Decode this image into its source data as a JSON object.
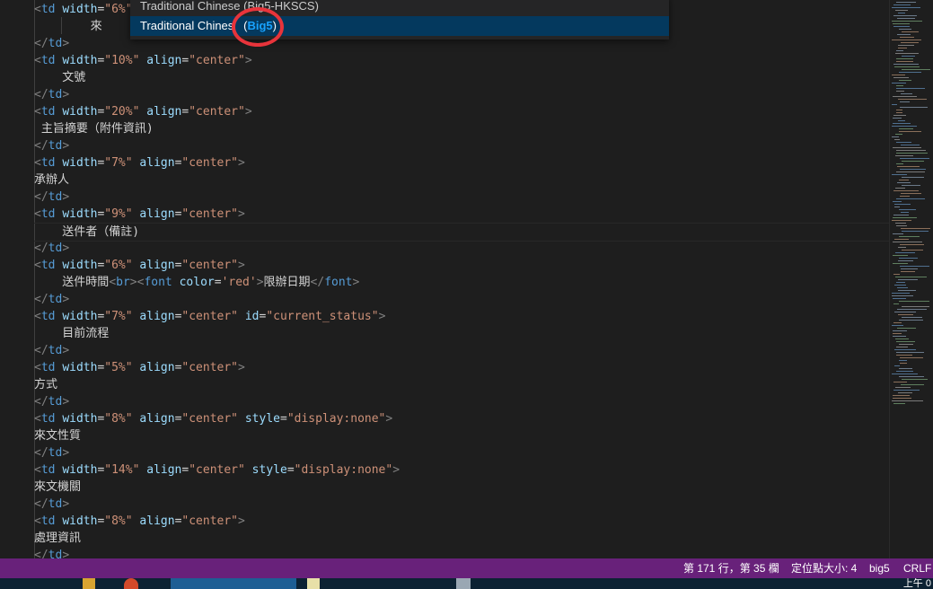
{
  "encoding_picker": {
    "items": [
      {
        "label": "Traditional Chinese (Big5-HKSCS)"
      },
      {
        "label_prefix": "Traditional Chines",
        "label_hidden": "e",
        "label_open": " (",
        "label_match": "Big5",
        "label_close": ")"
      }
    ]
  },
  "code_lines": [
    [
      {
        "t": "<",
        "c": "tg"
      },
      {
        "t": "td",
        "c": "tn"
      },
      {
        "t": " "
      },
      {
        "t": "width",
        "c": "an"
      },
      {
        "t": "=",
        "c": "tx"
      },
      {
        "t": "\"6%\"",
        "c": "av"
      }
    ],
    [
      {
        "t": "        來",
        "c": "tx"
      }
    ],
    [
      {
        "t": "</",
        "c": "tg"
      },
      {
        "t": "td",
        "c": "tn"
      },
      {
        "t": ">",
        "c": "tg"
      }
    ],
    [
      {
        "t": "<",
        "c": "tg"
      },
      {
        "t": "td",
        "c": "tn"
      },
      {
        "t": " "
      },
      {
        "t": "width",
        "c": "an"
      },
      {
        "t": "=",
        "c": "tx"
      },
      {
        "t": "\"10%\"",
        "c": "av"
      },
      {
        "t": " "
      },
      {
        "t": "align",
        "c": "an"
      },
      {
        "t": "=",
        "c": "tx"
      },
      {
        "t": "\"center\"",
        "c": "av"
      },
      {
        "t": ">",
        "c": "tg"
      }
    ],
    [
      {
        "t": "    文號",
        "c": "tx"
      }
    ],
    [
      {
        "t": "</",
        "c": "tg"
      },
      {
        "t": "td",
        "c": "tn"
      },
      {
        "t": ">",
        "c": "tg"
      }
    ],
    [
      {
        "t": "<",
        "c": "tg"
      },
      {
        "t": "td",
        "c": "tn"
      },
      {
        "t": " "
      },
      {
        "t": "width",
        "c": "an"
      },
      {
        "t": "=",
        "c": "tx"
      },
      {
        "t": "\"20%\"",
        "c": "av"
      },
      {
        "t": " "
      },
      {
        "t": "align",
        "c": "an"
      },
      {
        "t": "=",
        "c": "tx"
      },
      {
        "t": "\"center\"",
        "c": "av"
      },
      {
        "t": ">",
        "c": "tg"
      }
    ],
    [
      {
        "t": " 主旨摘要（附件資訊)",
        "c": "tx"
      }
    ],
    [
      {
        "t": "</",
        "c": "tg"
      },
      {
        "t": "td",
        "c": "tn"
      },
      {
        "t": ">",
        "c": "tg"
      }
    ],
    [
      {
        "t": "<",
        "c": "tg"
      },
      {
        "t": "td",
        "c": "tn"
      },
      {
        "t": " "
      },
      {
        "t": "width",
        "c": "an"
      },
      {
        "t": "=",
        "c": "tx"
      },
      {
        "t": "\"7%\"",
        "c": "av"
      },
      {
        "t": " "
      },
      {
        "t": "align",
        "c": "an"
      },
      {
        "t": "=",
        "c": "tx"
      },
      {
        "t": "\"center\"",
        "c": "av"
      },
      {
        "t": ">",
        "c": "tg"
      }
    ],
    [
      {
        "t": "承辦人",
        "c": "tx"
      }
    ],
    [
      {
        "t": "</",
        "c": "tg"
      },
      {
        "t": "td",
        "c": "tn"
      },
      {
        "t": ">",
        "c": "tg"
      }
    ],
    [
      {
        "t": "<",
        "c": "tg"
      },
      {
        "t": "td",
        "c": "tn"
      },
      {
        "t": " "
      },
      {
        "t": "width",
        "c": "an"
      },
      {
        "t": "=",
        "c": "tx"
      },
      {
        "t": "\"9%\"",
        "c": "av"
      },
      {
        "t": " "
      },
      {
        "t": "align",
        "c": "an"
      },
      {
        "t": "=",
        "c": "tx"
      },
      {
        "t": "\"center\"",
        "c": "av"
      },
      {
        "t": ">",
        "c": "tg"
      }
    ],
    [
      {
        "t": "    送件者（備註)",
        "c": "tx"
      }
    ],
    [
      {
        "t": "</",
        "c": "tg"
      },
      {
        "t": "td",
        "c": "tn"
      },
      {
        "t": ">",
        "c": "tg"
      }
    ],
    [
      {
        "t": "<",
        "c": "tg"
      },
      {
        "t": "td",
        "c": "tn"
      },
      {
        "t": " "
      },
      {
        "t": "width",
        "c": "an"
      },
      {
        "t": "=",
        "c": "tx"
      },
      {
        "t": "\"6%\"",
        "c": "av"
      },
      {
        "t": " "
      },
      {
        "t": "align",
        "c": "an"
      },
      {
        "t": "=",
        "c": "tx"
      },
      {
        "t": "\"center\"",
        "c": "av"
      },
      {
        "t": ">",
        "c": "tg"
      }
    ],
    [
      {
        "t": "    送件時間",
        "c": "tx"
      },
      {
        "t": "<",
        "c": "tg"
      },
      {
        "t": "br",
        "c": "tn"
      },
      {
        "t": ">",
        "c": "tg"
      },
      {
        "t": "<",
        "c": "tg"
      },
      {
        "t": "font",
        "c": "tn"
      },
      {
        "t": " "
      },
      {
        "t": "color",
        "c": "an"
      },
      {
        "t": "=",
        "c": "tx"
      },
      {
        "t": "'red'",
        "c": "av"
      },
      {
        "t": ">",
        "c": "tg"
      },
      {
        "t": "限辦日期",
        "c": "tx"
      },
      {
        "t": "</",
        "c": "tg"
      },
      {
        "t": "font",
        "c": "tn"
      },
      {
        "t": ">",
        "c": "tg"
      }
    ],
    [
      {
        "t": "</",
        "c": "tg"
      },
      {
        "t": "td",
        "c": "tn"
      },
      {
        "t": ">",
        "c": "tg"
      }
    ],
    [
      {
        "t": "<",
        "c": "tg"
      },
      {
        "t": "td",
        "c": "tn"
      },
      {
        "t": " "
      },
      {
        "t": "width",
        "c": "an"
      },
      {
        "t": "=",
        "c": "tx"
      },
      {
        "t": "\"7%\"",
        "c": "av"
      },
      {
        "t": " "
      },
      {
        "t": "align",
        "c": "an"
      },
      {
        "t": "=",
        "c": "tx"
      },
      {
        "t": "\"center\"",
        "c": "av"
      },
      {
        "t": " "
      },
      {
        "t": "id",
        "c": "an"
      },
      {
        "t": "=",
        "c": "tx"
      },
      {
        "t": "\"current_status\"",
        "c": "av"
      },
      {
        "t": ">",
        "c": "tg"
      }
    ],
    [
      {
        "t": "    目前流程",
        "c": "tx"
      }
    ],
    [
      {
        "t": "</",
        "c": "tg"
      },
      {
        "t": "td",
        "c": "tn"
      },
      {
        "t": ">",
        "c": "tg"
      }
    ],
    [
      {
        "t": "<",
        "c": "tg"
      },
      {
        "t": "td",
        "c": "tn"
      },
      {
        "t": " "
      },
      {
        "t": "width",
        "c": "an"
      },
      {
        "t": "=",
        "c": "tx"
      },
      {
        "t": "\"5%\"",
        "c": "av"
      },
      {
        "t": " "
      },
      {
        "t": "align",
        "c": "an"
      },
      {
        "t": "=",
        "c": "tx"
      },
      {
        "t": "\"center\"",
        "c": "av"
      },
      {
        "t": ">",
        "c": "tg"
      }
    ],
    [
      {
        "t": "方式",
        "c": "tx"
      }
    ],
    [
      {
        "t": "</",
        "c": "tg"
      },
      {
        "t": "td",
        "c": "tn"
      },
      {
        "t": ">",
        "c": "tg"
      }
    ],
    [
      {
        "t": "<",
        "c": "tg"
      },
      {
        "t": "td",
        "c": "tn"
      },
      {
        "t": " "
      },
      {
        "t": "width",
        "c": "an"
      },
      {
        "t": "=",
        "c": "tx"
      },
      {
        "t": "\"8%\"",
        "c": "av"
      },
      {
        "t": " "
      },
      {
        "t": "align",
        "c": "an"
      },
      {
        "t": "=",
        "c": "tx"
      },
      {
        "t": "\"center\"",
        "c": "av"
      },
      {
        "t": " "
      },
      {
        "t": "style",
        "c": "an"
      },
      {
        "t": "=",
        "c": "tx"
      },
      {
        "t": "\"display:none\"",
        "c": "av"
      },
      {
        "t": ">",
        "c": "tg"
      }
    ],
    [
      {
        "t": "來文性質",
        "c": "tx"
      }
    ],
    [
      {
        "t": "</",
        "c": "tg"
      },
      {
        "t": "td",
        "c": "tn"
      },
      {
        "t": ">",
        "c": "tg"
      }
    ],
    [
      {
        "t": "<",
        "c": "tg"
      },
      {
        "t": "td",
        "c": "tn"
      },
      {
        "t": " "
      },
      {
        "t": "width",
        "c": "an"
      },
      {
        "t": "=",
        "c": "tx"
      },
      {
        "t": "\"14%\"",
        "c": "av"
      },
      {
        "t": " "
      },
      {
        "t": "align",
        "c": "an"
      },
      {
        "t": "=",
        "c": "tx"
      },
      {
        "t": "\"center\"",
        "c": "av"
      },
      {
        "t": " "
      },
      {
        "t": "style",
        "c": "an"
      },
      {
        "t": "=",
        "c": "tx"
      },
      {
        "t": "\"display:none\"",
        "c": "av"
      },
      {
        "t": ">",
        "c": "tg"
      }
    ],
    [
      {
        "t": "來文機關",
        "c": "tx"
      }
    ],
    [
      {
        "t": "</",
        "c": "tg"
      },
      {
        "t": "td",
        "c": "tn"
      },
      {
        "t": ">",
        "c": "tg"
      }
    ],
    [
      {
        "t": "<",
        "c": "tg"
      },
      {
        "t": "td",
        "c": "tn"
      },
      {
        "t": " "
      },
      {
        "t": "width",
        "c": "an"
      },
      {
        "t": "=",
        "c": "tx"
      },
      {
        "t": "\"8%\"",
        "c": "av"
      },
      {
        "t": " "
      },
      {
        "t": "align",
        "c": "an"
      },
      {
        "t": "=",
        "c": "tx"
      },
      {
        "t": "\"center\"",
        "c": "av"
      },
      {
        "t": ">",
        "c": "tg"
      }
    ],
    [
      {
        "t": "處理資訊",
        "c": "tx"
      }
    ],
    [
      {
        "t": "</",
        "c": "tg"
      },
      {
        "t": "td",
        "c": "tn"
      },
      {
        "t": ">",
        "c": "tg"
      }
    ]
  ],
  "status_bar": {
    "position": "第 171 行，第 35 欄",
    "indent": "定位點大小: 4",
    "encoding": "big5",
    "eol": "CRLF"
  },
  "taskbar": {
    "clock": "上午 0"
  },
  "colors": {
    "status_bar_bg": "#68217a",
    "selection_bg": "#04395e",
    "highlight_circle": "#e8343b",
    "match_text": "#18a3ff"
  }
}
